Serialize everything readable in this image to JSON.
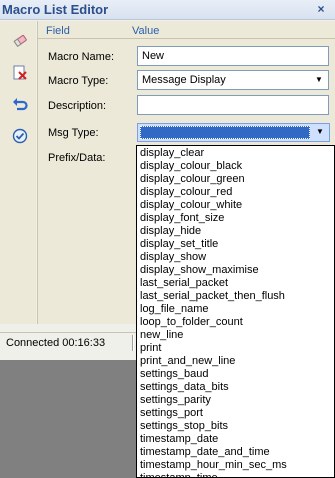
{
  "window": {
    "title": "Macro List Editor",
    "close_glyph": "×"
  },
  "toolbar": {
    "tools": [
      {
        "icon": "eraser-icon"
      },
      {
        "icon": "delete-icon"
      },
      {
        "icon": "undo-icon"
      },
      {
        "icon": "apply-icon"
      }
    ]
  },
  "grid": {
    "columns": [
      "Field",
      "Value"
    ],
    "rows": [
      {
        "label": "Macro Name:",
        "value": "New"
      },
      {
        "label": "Macro Type:",
        "value": "Message Display"
      },
      {
        "label": "Description:",
        "value": ""
      },
      {
        "label": "Msg Type:",
        "value": ""
      },
      {
        "label": "Prefix/Data:",
        "value": ""
      }
    ]
  },
  "status": {
    "text": "Connected 00:16:33"
  },
  "dropdown": {
    "items": [
      "display_clear",
      "display_colour_black",
      "display_colour_green",
      "display_colour_red",
      "display_colour_white",
      "display_font_size",
      "display_hide",
      "display_set_title",
      "display_show",
      "display_show_maximise",
      "last_serial_packet",
      "last_serial_packet_then_flush",
      "log_file_name",
      "loop_to_folder_count",
      "new_line",
      "print",
      "print_and_new_line",
      "settings_baud",
      "settings_data_bits",
      "settings_parity",
      "settings_port",
      "settings_stop_bits",
      "timestamp_date",
      "timestamp_date_and_time",
      "timestamp_hour_min_sec_ms",
      "timestamp_time"
    ]
  },
  "colors": {
    "title_text": "#2a4f8c",
    "column_header": "#2a5faa",
    "selection": "#316ac5",
    "panel_bg": "#ece9d8",
    "desktop": "#808080"
  }
}
